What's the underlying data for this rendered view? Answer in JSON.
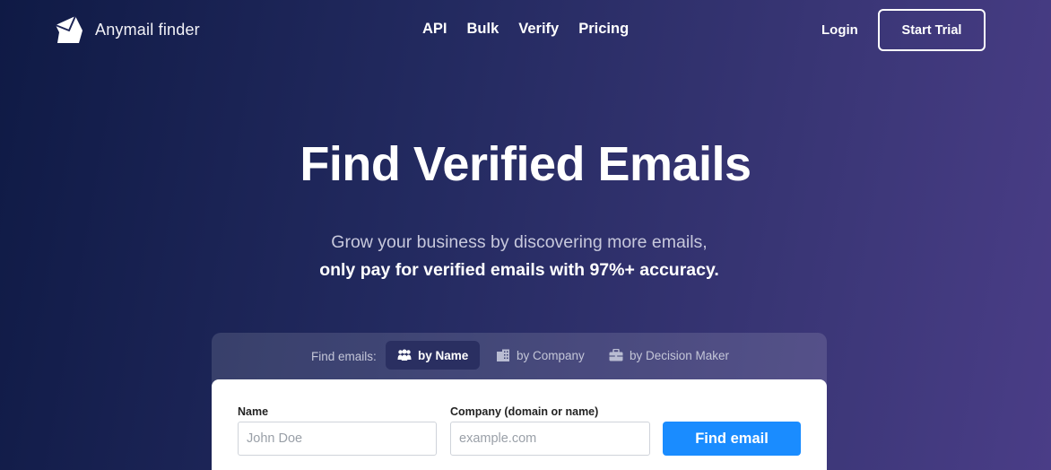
{
  "header": {
    "brand": "Anymail finder",
    "nav": [
      "API",
      "Bulk",
      "Verify",
      "Pricing"
    ],
    "login_label": "Login",
    "trial_label": "Start Trial"
  },
  "hero": {
    "title": "Find Verified Emails",
    "subtitle_line1": "Grow your business by discovering more emails,",
    "subtitle_line2": "only pay for verified emails with 97%+ accuracy."
  },
  "search": {
    "tabs_label": "Find emails:",
    "tabs": [
      {
        "label": "by Name",
        "icon": "people-icon",
        "active": true
      },
      {
        "label": "by Company",
        "icon": "building-icon",
        "active": false
      },
      {
        "label": "by Decision Maker",
        "icon": "briefcase-icon",
        "active": false
      }
    ],
    "name_label": "Name",
    "name_placeholder": "John Doe",
    "company_label": "Company (domain or name)",
    "company_placeholder": "example.com",
    "button_label": "Find email"
  },
  "colors": {
    "accent": "#1a8cff",
    "active_tab": "#2a2f61",
    "background_start": "#0f1a45",
    "background_end": "#4a3d87"
  }
}
